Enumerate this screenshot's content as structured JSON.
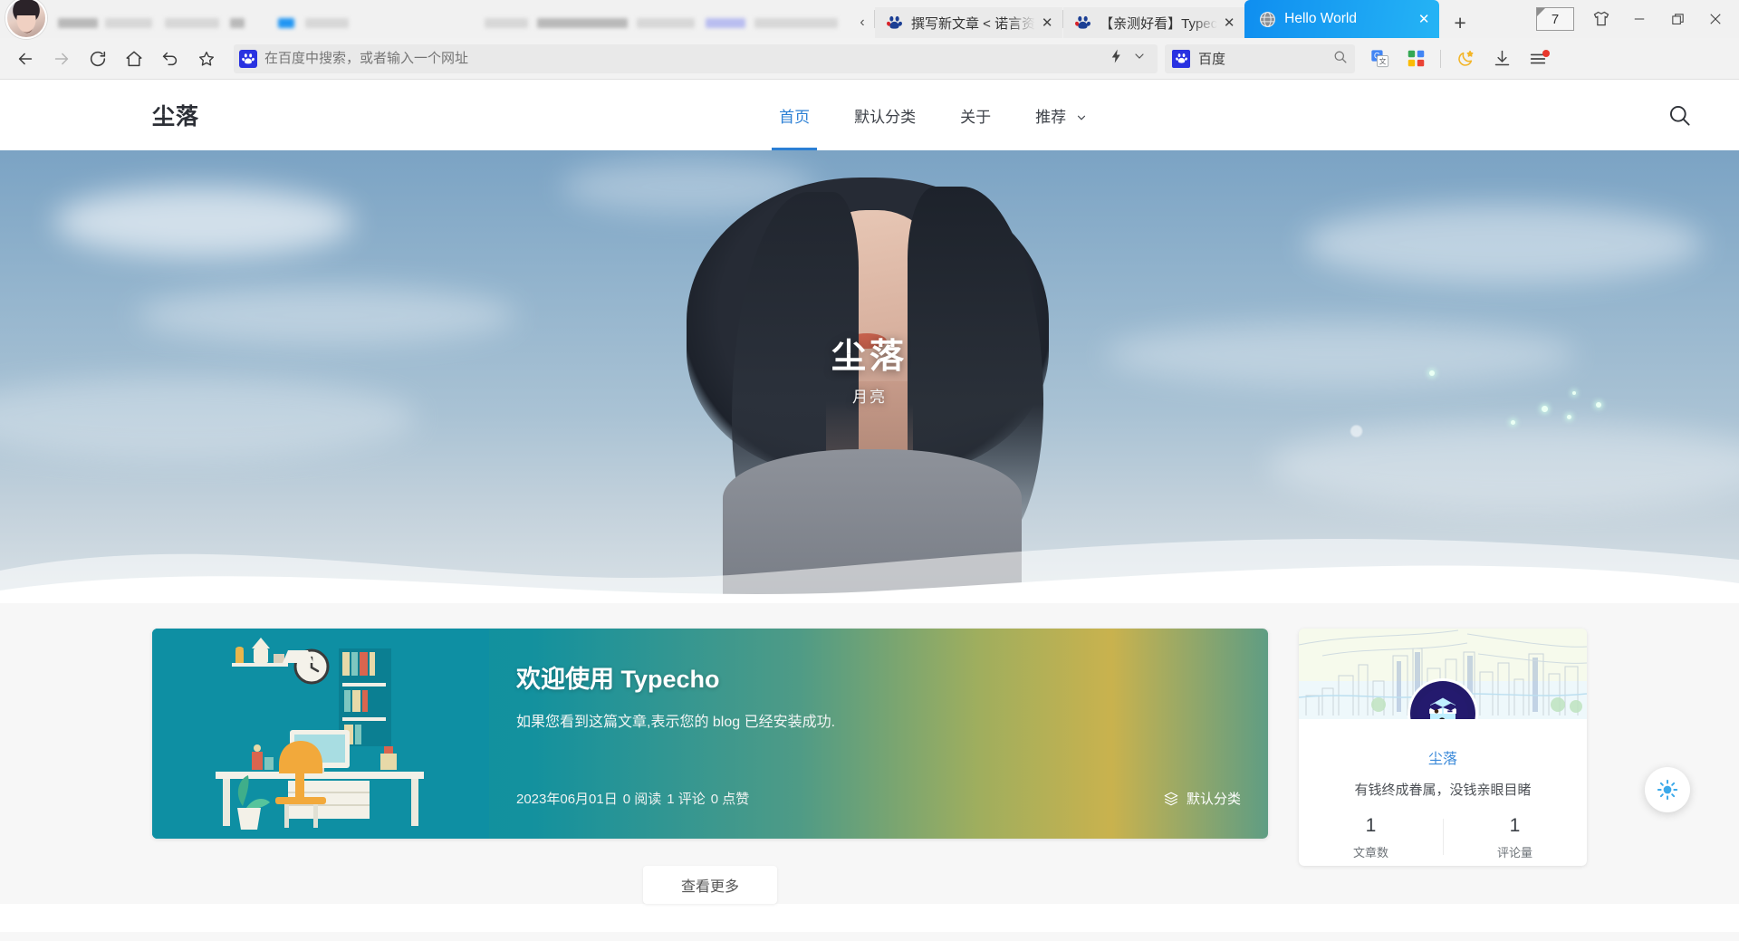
{
  "browser": {
    "tabs": [
      {
        "title": "",
        "blurred": true,
        "active": false,
        "favicon": "blurred-icon"
      },
      {
        "title": "",
        "blurred": true,
        "active": false,
        "favicon": "blurred-icon"
      },
      {
        "title": "",
        "blurred": true,
        "active": false,
        "favicon": "blurred-icon"
      },
      {
        "title": "撰写新文章 < 诺言资",
        "blurred": false,
        "active": false,
        "favicon": "baidu-favicon"
      },
      {
        "title": "【亲测好看】Typec",
        "blurred": false,
        "active": false,
        "favicon": "baidu-favicon"
      },
      {
        "title": "Hello World",
        "blurred": false,
        "active": true,
        "favicon": "globe-favicon"
      }
    ],
    "tab_overflow_label": "‹",
    "newtab_label": "+",
    "window_controls": {
      "skin_count": "7",
      "skin_icon": "tshirt-icon",
      "minimize": "—",
      "maximize": "maximize-icon",
      "close": "✕"
    },
    "nav": {
      "back": "back-arrow-icon",
      "forward": "forward-arrow-icon",
      "reload": "reload-icon",
      "home": "home-icon",
      "history_back": "undo-arrow-icon",
      "bookmark": "star-icon"
    },
    "omnibox": {
      "placeholder": "在百度中搜索，或者输入一个网址",
      "value": "",
      "engine_icon": "baidu-paw-icon",
      "lightning_icon": "lightning-icon",
      "dropdown_icon": "chevron-down-icon"
    },
    "searchbox": {
      "engine": "百度",
      "engine_icon": "baidu-paw-icon",
      "search_icon": "search-icon"
    },
    "toolbar_icons": [
      "google-translate-icon",
      "apps-grid-icon",
      "night-mode-icon",
      "download-icon",
      "menu-icon"
    ]
  },
  "site": {
    "logo": "尘落",
    "nav": [
      {
        "label": "首页",
        "active": true,
        "has_dropdown": false
      },
      {
        "label": "默认分类",
        "active": false,
        "has_dropdown": false
      },
      {
        "label": "关于",
        "active": false,
        "has_dropdown": false
      },
      {
        "label": "推荐",
        "active": false,
        "has_dropdown": true
      }
    ],
    "search_icon": "search-icon",
    "hero": {
      "title": "尘落",
      "subtitle": "月亮"
    },
    "post": {
      "title": "欢迎使用 Typecho",
      "excerpt": "如果您看到这篇文章,表示您的 blog 已经安装成功.",
      "date": "2023年06月01日",
      "reads": "0 阅读",
      "comments": "1 评论",
      "likes": "0 点赞",
      "category": "默认分类",
      "category_icon": "layers-icon"
    },
    "more_button": "查看更多",
    "profile": {
      "name": "尘落",
      "motto": "有钱终成眷属，没钱亲眼目睹",
      "avatar_icon": "robot-face-avatar",
      "stats": [
        {
          "value": "1",
          "label": "文章数"
        },
        {
          "value": "1",
          "label": "评论量"
        }
      ]
    },
    "theme_fab_icon": "brightness-icon",
    "colors": {
      "accent": "#2b7fd4",
      "profile_name": "#3b8ad9",
      "active_tab_start": "#0f8ef0",
      "active_tab_end": "#25b4f5",
      "card_teal": "#0e8fa3"
    }
  }
}
